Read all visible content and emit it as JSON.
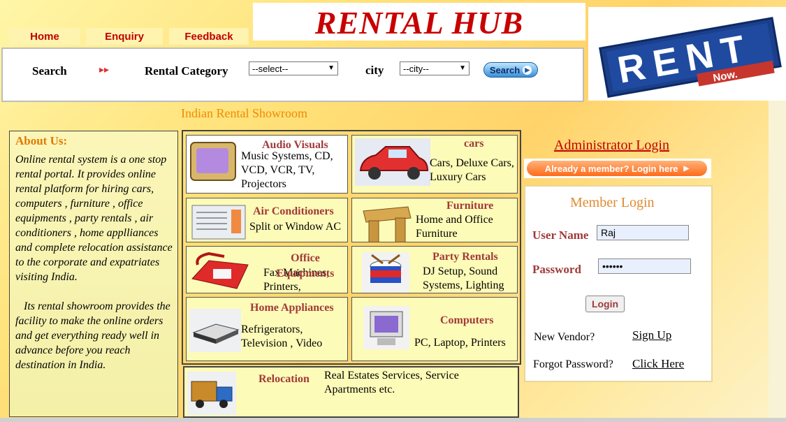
{
  "nav": {
    "home": "Home",
    "enquiry": "Enquiry",
    "feedback": "Feedback"
  },
  "site_title": "RENTAL HUB",
  "logo": {
    "line1": "RENT",
    "line2": "Now."
  },
  "search": {
    "label": "Search",
    "arrows": "▸▸",
    "category_label": "Rental Category",
    "category_value": "--select--",
    "city_label": "city",
    "city_value": "--city--",
    "button": "Search"
  },
  "showroom_heading": "Indian Rental Showroom",
  "about": {
    "title": "About Us:",
    "para1": "Online rental system is a one stop rental portal. It provides online rental platform for hiring cars, computers , furniture , office equipments , party rentals , air conditioners , home applliances and complete relocation assistance to the corporate and expatriates visiting India.",
    "para2": "Its rental showroom provides the facility to make the online orders and get everything ready well in advance before you reach destination in India."
  },
  "categories": {
    "audio": {
      "title": "Audio Visuals",
      "text": "Music Systems, CD, VCD, VCR, TV, Projectors"
    },
    "cars": {
      "title": "cars",
      "text": "Cars, Deluxe Cars, Luxury Cars"
    },
    "ac": {
      "title": "Air Conditioners",
      "text": "Split or Window AC"
    },
    "furniture": {
      "title": "Furniture",
      "text": "Home and Office Furniture"
    },
    "office": {
      "title": "Office Equipments",
      "text": "Fax Machines, Printers,"
    },
    "party": {
      "title": "Party Rentals",
      "text": "DJ Setup, Sound Systems, Lighting"
    },
    "home": {
      "title": "Home Appliances",
      "text": "Refrigerators, Television , Video"
    },
    "computers": {
      "title": "Computers",
      "text": "PC, Laptop, Printers"
    },
    "relocation": {
      "title": "Relocation",
      "text": "Real Estates Services, Service Apartments etc."
    }
  },
  "admin_login": "Administrator Login",
  "already_member": "Already a member? Login here",
  "login": {
    "title": "Member Login",
    "username_label": "User Name",
    "username_value": "Raj",
    "password_label": "Password",
    "password_value": "••••••",
    "button": "Login",
    "new_vendor": "New Vendor?",
    "sign_up": "Sign Up",
    "forgot": "Forgot Password?",
    "click_here": "Click Here"
  },
  "colors": {
    "title_red": "#c80000",
    "accent_orange": "#f08a00",
    "label_maroon": "#a03a3a"
  }
}
